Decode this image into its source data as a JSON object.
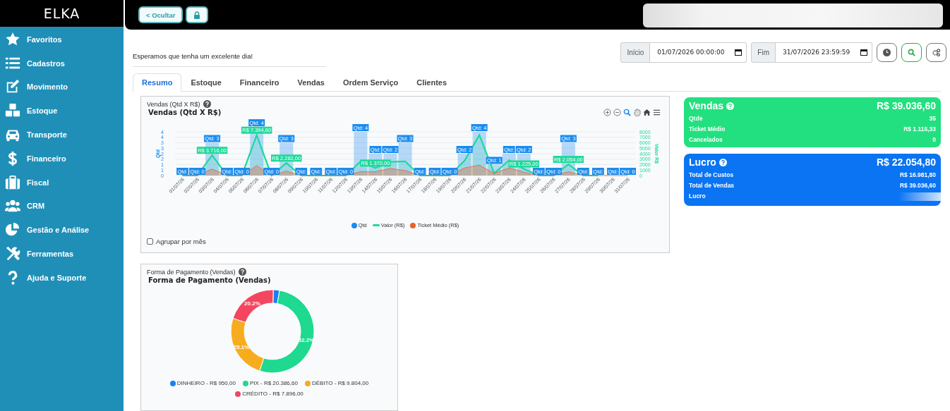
{
  "sidebar": {
    "brand": "ELKA",
    "items": [
      {
        "label": "Favoritos"
      },
      {
        "label": "Cadastros"
      },
      {
        "label": "Movimento"
      },
      {
        "label": "Estoque"
      },
      {
        "label": "Transporte"
      },
      {
        "label": "Financeiro"
      },
      {
        "label": "Fiscal"
      },
      {
        "label": "CRM"
      },
      {
        "label": "Gestão e Análise"
      },
      {
        "label": "Ferramentas"
      },
      {
        "label": "Ajuda e Suporte"
      }
    ]
  },
  "topbar": {
    "hide_button": "< Ocultar"
  },
  "greeting": "Esperamos que tenha um excelente dia!",
  "filters": {
    "start_label": "Início",
    "start_value": "01/07/2026 00:00:00",
    "end_label": "Fim",
    "end_value": "31/07/2026 23:59:59"
  },
  "tabs": [
    {
      "label": "Resumo",
      "selected": true
    },
    {
      "label": "Estoque",
      "selected": false
    },
    {
      "label": "Financeiro",
      "selected": false
    },
    {
      "label": "Vendas",
      "selected": false
    },
    {
      "label": "Ordem Serviço",
      "selected": false
    },
    {
      "label": "Clientes",
      "selected": false
    }
  ],
  "sales_chart": {
    "heading": "Vendas (Qtd X R$)",
    "group_by_month": {
      "label": "Agrupar por mês",
      "checked": false
    },
    "chart_data": {
      "type": "line",
      "title": "Vendas (Qtd X R$)",
      "ylabel": "Qtd",
      "y2label": "Valor R$",
      "legend": "bottom",
      "grid": true,
      "categories": [
        "01/07/26",
        "02/07/26",
        "03/07/26",
        "04/07/26",
        "05/07/26",
        "06/07/26",
        "07/07/26",
        "08/07/26",
        "09/07/26",
        "10/07/26",
        "11/07/26",
        "12/07/26",
        "13/07/26",
        "14/07/26",
        "15/07/26",
        "16/07/26",
        "17/07/26",
        "18/07/26",
        "19/07/26",
        "20/07/26",
        "21/07/26",
        "22/07/26",
        "23/07/26",
        "24/07/26",
        "25/07/26",
        "26/07/26",
        "27/07/26",
        "28/07/26",
        "29/07/26",
        "30/07/26",
        "31/07/26"
      ],
      "ylim": [
        0,
        4
      ],
      "yticks": [
        0,
        {
          "value": 0.5,
          "label": "1"
        },
        1,
        {
          "value": 1.5,
          "label": "2"
        },
        2,
        {
          "value": 2.5,
          "label": "3"
        },
        3,
        {
          "value": 3.5,
          "label": "4"
        },
        4
      ],
      "y2lim": [
        0,
        8000
      ],
      "y2ticks": [
        0,
        1000,
        2000,
        3000,
        4000,
        5000,
        6000,
        7000,
        8000
      ],
      "series": [
        {
          "name": "Qtd",
          "color": "#1a8cf0",
          "type": "bar",
          "values": [
            0,
            0,
            3,
            0,
            0,
            4,
            0,
            3,
            0,
            0,
            0,
            0,
            4,
            2,
            2,
            3,
            0,
            0,
            0,
            2,
            4,
            1,
            2,
            2,
            0,
            0,
            3,
            0,
            0,
            0,
            0
          ],
          "value_labels": [
            "Qtd:",
            "Qtd: 0",
            "Qtd: 3",
            "Qtd:",
            "Qtd: 0",
            "Qtd: 4",
            "Qtd: 0",
            "Qtd: 3",
            "Qtd:",
            "Qtd:",
            "Qtd:",
            "Qtd: 0",
            "Qtd: 4",
            "Qtd:",
            "Qtd: 2",
            "Qtd: 3",
            "Qtd:",
            "Qtd:",
            "Qtd: 0",
            "Qtd: 2",
            "Qtd: 4",
            "Qtd: 1",
            "Qtd:",
            "Qtd: 2",
            "Qtd:",
            "Qtd: 0",
            "Qtd: 3",
            "Qtd:",
            "Qtd:",
            "Qtd:",
            "Qtd: 0"
          ]
        },
        {
          "name": "Valor (R$)",
          "color": "#1ed99a",
          "type": "line",
          "axis": "y2",
          "values": [
            0,
            0,
            3716,
            0,
            0,
            7394.6,
            0,
            2282,
            0,
            0,
            0,
            0,
            2600,
            1370,
            2500,
            2600,
            0,
            0,
            0,
            2700,
            7400,
            400,
            2800,
            1225,
            0,
            0,
            2054,
            0,
            0,
            null,
            null
          ],
          "value_labels": [
            null,
            null,
            "R$ 3.716,00",
            null,
            null,
            "R$ 7.394,60",
            null,
            "R$ 2.282,00",
            null,
            null,
            null,
            null,
            null,
            "R$ 1.370,00",
            null,
            null,
            null,
            null,
            null,
            null,
            null,
            null,
            null,
            "R$ 1.225,00",
            null,
            null,
            "R$ 2.054,00",
            null,
            null,
            null,
            null
          ]
        },
        {
          "name": "Ticket Médio (R$)",
          "color": "#e8622a",
          "type": "area",
          "axis": "y2",
          "values": [
            0,
            0,
            1200,
            0,
            0,
            1800,
            0,
            800,
            0,
            0,
            0,
            0,
            700,
            700,
            1300,
            900,
            0,
            0,
            0,
            1400,
            1900,
            400,
            1400,
            600,
            0,
            0,
            700,
            0,
            0,
            0,
            0
          ]
        }
      ]
    }
  },
  "payment_chart": {
    "heading": "Forma de Pagamento (Vendas)",
    "chart_data": {
      "type": "donut",
      "title": "Forma de Pagamento (Vendas)",
      "legend": "bottom",
      "categories": [
        "DINHEIRO - R$ 950,00",
        "PIX - R$ 20.386,60",
        "DÉBITO - R$ 9.804,00",
        "CRÉDITO - R$ 7.896,00"
      ],
      "series": [
        {
          "values": [
            950,
            20386.6,
            9804,
            7896
          ],
          "colors": [
            "#1a7ff0",
            "#1ed98f",
            "#f7ac1e",
            "#f5465f"
          ]
        }
      ],
      "value_labels": [
        null,
        "52.2%",
        "25.1%",
        "20.2%"
      ]
    }
  },
  "cards": [
    {
      "kind": "sales",
      "color": "#22e07f",
      "title": "Vendas",
      "total": "R$ 39.036,60",
      "rows": [
        {
          "label": "Qtde",
          "value": "35"
        },
        {
          "label": "Ticket Médio",
          "value": "R$ 1.115,33"
        },
        {
          "label": "Cancelados",
          "value": "0"
        }
      ]
    },
    {
      "kind": "profit",
      "color": "#0a74f2",
      "title": "Lucro",
      "total": "R$ 22.054,80",
      "rows": [
        {
          "label": "Total de Custos",
          "value": "R$ 16.981,80"
        },
        {
          "label": "Total de Vendas",
          "value": "R$ 39.036,60"
        },
        {
          "label": "Lucro"
        }
      ]
    }
  ]
}
